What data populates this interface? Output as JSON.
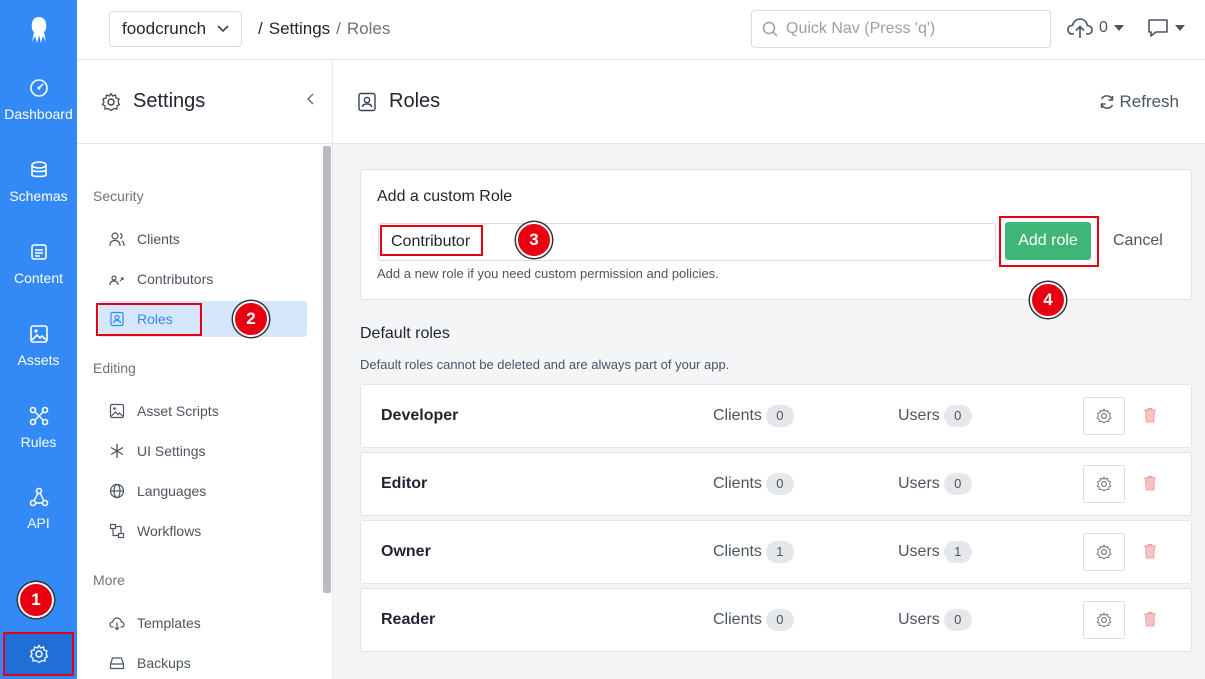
{
  "colors": {
    "accent": "#3389f6",
    "success": "#3fb577",
    "danger": "#e60012"
  },
  "rail": {
    "items": [
      {
        "label": "Dashboard",
        "icon": "dashboard-icon"
      },
      {
        "label": "Schemas",
        "icon": "database-icon"
      },
      {
        "label": "Content",
        "icon": "content-icon"
      },
      {
        "label": "Assets",
        "icon": "image-icon"
      },
      {
        "label": "Rules",
        "icon": "rules-icon"
      },
      {
        "label": "API",
        "icon": "api-icon"
      }
    ]
  },
  "topbar": {
    "app_name": "foodcrunch",
    "breadcrumb": {
      "sep1": "/",
      "settings": "Settings",
      "sep2": "/",
      "current": "Roles"
    },
    "quicknav_placeholder": "Quick Nav (Press 'q')",
    "uploads_count": "0"
  },
  "sidebar": {
    "title": "Settings",
    "sections": {
      "security": "Security",
      "editing": "Editing",
      "more": "More"
    },
    "items": {
      "clients": "Clients",
      "contributors": "Contributors",
      "roles": "Roles",
      "asset_scripts": "Asset Scripts",
      "ui_settings": "UI Settings",
      "languages": "Languages",
      "workflows": "Workflows",
      "templates": "Templates",
      "backups": "Backups"
    }
  },
  "main": {
    "title": "Roles",
    "refresh_label": "Refresh",
    "add_role": {
      "title": "Add a custom Role",
      "input_value": "Contributor",
      "hint": "Add a new role if you need custom permission and policies.",
      "add_label": "Add role",
      "cancel_label": "Cancel"
    },
    "default_roles": {
      "title": "Default roles",
      "hint": "Default roles cannot be deleted and are always part of your app.",
      "clients_label": "Clients",
      "users_label": "Users",
      "rows": [
        {
          "name": "Developer",
          "clients": "0",
          "users": "0"
        },
        {
          "name": "Editor",
          "clients": "0",
          "users": "0"
        },
        {
          "name": "Owner",
          "clients": "1",
          "users": "1"
        },
        {
          "name": "Reader",
          "clients": "0",
          "users": "0"
        }
      ]
    }
  },
  "markers": {
    "m1": "1",
    "m2": "2",
    "m3": "3",
    "m4": "4"
  }
}
